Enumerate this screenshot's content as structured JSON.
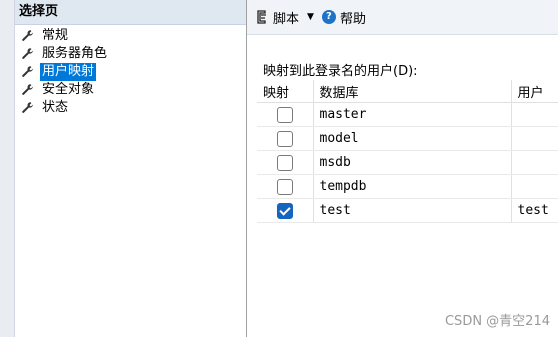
{
  "left_panel": {
    "header": "选择页",
    "items": [
      {
        "label": "常规",
        "selected": false
      },
      {
        "label": "服务器角色",
        "selected": false
      },
      {
        "label": "用户映射",
        "selected": true
      },
      {
        "label": "安全对象",
        "selected": false
      },
      {
        "label": "状态",
        "selected": false
      }
    ]
  },
  "toolbar": {
    "script_label": "脚本",
    "help_label": "帮助"
  },
  "mapping": {
    "section_label": "映射到此登录名的用户(D):",
    "columns": [
      "映射",
      "数据库",
      "用户"
    ],
    "rows": [
      {
        "mapped": false,
        "database": "master",
        "user": ""
      },
      {
        "mapped": false,
        "database": "model",
        "user": ""
      },
      {
        "mapped": false,
        "database": "msdb",
        "user": ""
      },
      {
        "mapped": false,
        "database": "tempdb",
        "user": ""
      },
      {
        "mapped": true,
        "database": "test",
        "user": "test"
      }
    ]
  },
  "watermark": "CSDN @青空214",
  "colors": {
    "selection": "#0078d7",
    "checkbox_checked": "#1565c0",
    "header_bg": "#dfe7f1"
  }
}
